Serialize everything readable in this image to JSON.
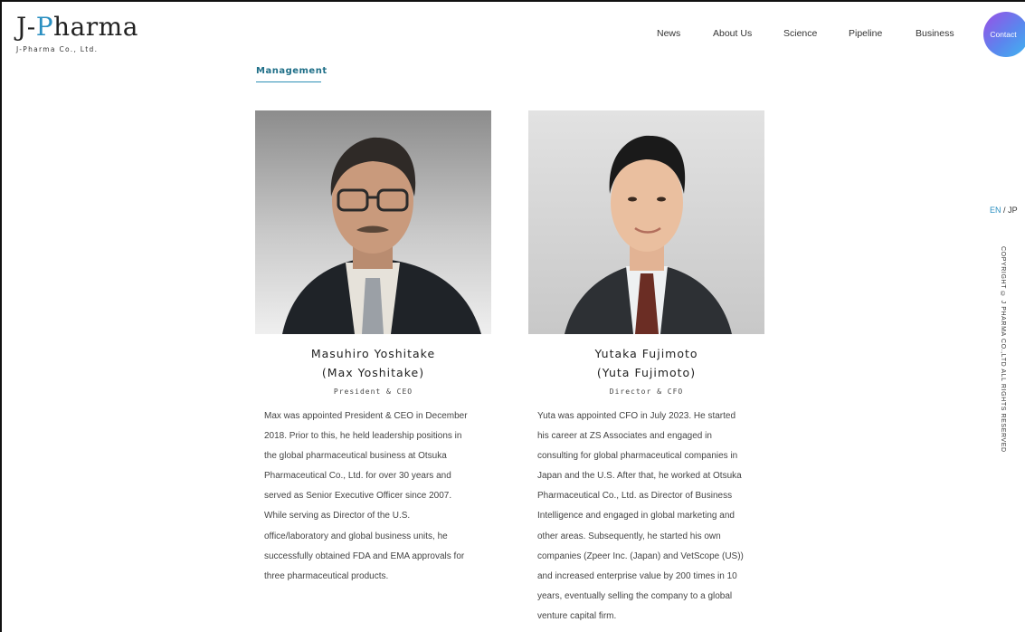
{
  "brand": {
    "logo_prefix": "J-",
    "logo_accent": "P",
    "logo_suffix": "harma",
    "company_name": "J-Pharma Co., Ltd."
  },
  "nav": {
    "items": [
      "News",
      "About Us",
      "Science",
      "Pipeline",
      "Business"
    ],
    "contact_label": "Contact"
  },
  "section": {
    "title": "Management"
  },
  "people": [
    {
      "name": "Masuhiro Yoshitake",
      "alias": "(Max Yoshitake)",
      "role": "President & CEO",
      "bio_lines": [
        "Max was appointed President & CEO in December",
        "2018. Prior to this, he held leadership positions in",
        "the global pharmaceutical business at Otsuka",
        "Pharmaceutical Co., Ltd. for over 30 years and",
        "served as Senior Executive Officer since 2007.",
        "While serving as Director of the U.S.",
        "office/laboratory and global business units, he",
        "successfully obtained FDA and EMA approvals for",
        "three pharmaceutical products."
      ]
    },
    {
      "name": "Yutaka Fujimoto",
      "alias": "(Yuta Fujimoto)",
      "role": "Director & CFO",
      "bio_lines": [
        "Yuta was appointed CFO in July 2023. He started",
        "his career at ZS Associates and engaged in",
        "consulting for global pharmaceutical companies in",
        "Japan and the U.S. After that, he worked at Otsuka",
        "Pharmaceutical Co., Ltd. as Director of Business",
        "Intelligence and engaged in global marketing and",
        "other areas. Subsequently, he started his own",
        "companies (Zpeer Inc. (Japan) and VetScope (US))",
        "and increased enterprise value by 200 times in 10",
        "years, eventually selling the company to a global",
        "venture capital firm."
      ]
    }
  ],
  "language": {
    "en": "EN",
    "separator": "/",
    "jp": "JP"
  },
  "footer": {
    "copyright": "COPYRIGHT © J PHARMA CO.,LTD ALL RIGHTS RESERVED"
  },
  "colors": {
    "accent": "#2a8fc1",
    "section_title": "#1f6f88",
    "contact_gradient_start": "#9a4fe6",
    "contact_gradient_end": "#3fb7f0"
  },
  "icons": {
    "photo_left": "portrait-photo",
    "photo_right": "portrait-photo"
  }
}
